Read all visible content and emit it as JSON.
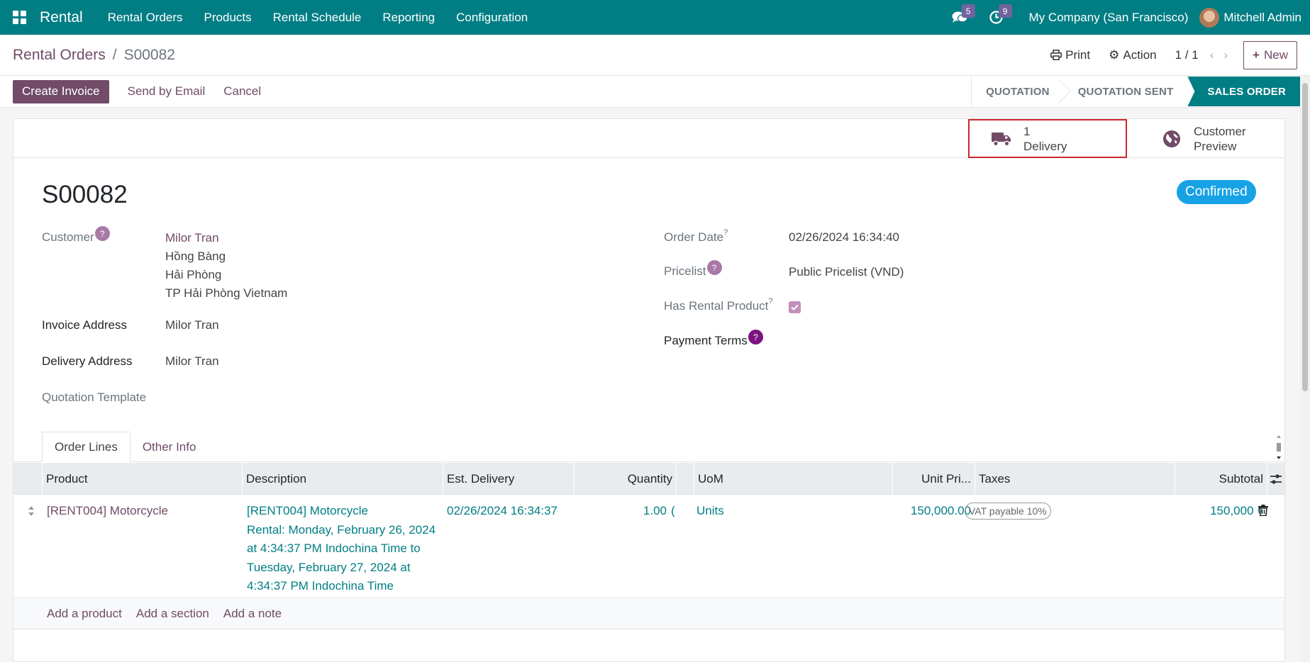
{
  "navbar": {
    "brand": "Rental",
    "menu": [
      "Rental Orders",
      "Products",
      "Rental Schedule",
      "Reporting",
      "Configuration"
    ],
    "messages_count": "5",
    "activities_count": "9",
    "company": "My Company (San Francisco)",
    "user": "Mitchell Admin"
  },
  "control_panel": {
    "breadcrumb_parent": "Rental Orders",
    "breadcrumb_separator": "/",
    "breadcrumb_current": "S00082",
    "print_label": "Print",
    "action_label": "Action",
    "pager": "1 / 1",
    "new_label": "New"
  },
  "statusbar": {
    "create_invoice": "Create Invoice",
    "send_email": "Send by Email",
    "cancel": "Cancel",
    "stages": [
      "QUOTATION",
      "QUOTATION SENT",
      "SALES ORDER"
    ],
    "active_stage": "SALES ORDER"
  },
  "smart_buttons": {
    "delivery_count": "1",
    "delivery_label": "Delivery",
    "preview_line1": "Customer",
    "preview_line2": "Preview"
  },
  "record": {
    "name": "S00082",
    "status_badge": "Confirmed",
    "customer_label": "Customer",
    "customer_name": "Milor Tran",
    "customer_address": [
      "Hồng Bàng",
      "Hải Phòng",
      "TP Hải Phòng Vietnam"
    ],
    "invoice_address_label": "Invoice Address",
    "invoice_address": "Milor Tran",
    "delivery_address_label": "Delivery Address",
    "delivery_address": "Milor Tran",
    "quotation_template_label": "Quotation Template",
    "order_date_label": "Order Date",
    "order_date": "02/26/2024 16:34:40",
    "pricelist_label": "Pricelist",
    "pricelist": "Public Pricelist (VND)",
    "has_rental_label": "Has Rental Product",
    "has_rental": true,
    "payment_terms_label": "Payment Terms",
    "help_glyph": "?"
  },
  "tabs": [
    "Order Lines",
    "Other Info"
  ],
  "table": {
    "headers": {
      "product": "Product",
      "description": "Description",
      "est_delivery": "Est. Delivery",
      "quantity": "Quantity",
      "uom": "UoM",
      "unit_price": "Unit Pri...",
      "taxes": "Taxes",
      "subtotal": "Subtotal"
    },
    "rows": [
      {
        "product": "[RENT004] Motorcycle",
        "description": [
          "[RENT004] Motorcycle",
          "Rental: Monday, February 26, 2024",
          "at 4:34:37 PM Indochina Time to",
          "Tuesday, February 27, 2024 at",
          "4:34:37 PM Indochina Time"
        ],
        "est_delivery": "02/26/2024 16:34:37",
        "quantity": "1.00",
        "quantity_overflow": "(",
        "uom": "Units",
        "unit_price": "150,000.00",
        "taxes": "VAT payable 10%",
        "subtotal": "150,000 ₫"
      }
    ],
    "add_links": [
      "Add a product",
      "Add a section",
      "Add a note"
    ]
  },
  "colors": {
    "navbar": "#017e84",
    "primary": "#714b67",
    "confirmed_badge": "#17a2e6",
    "highlight_border": "#d0262d"
  }
}
